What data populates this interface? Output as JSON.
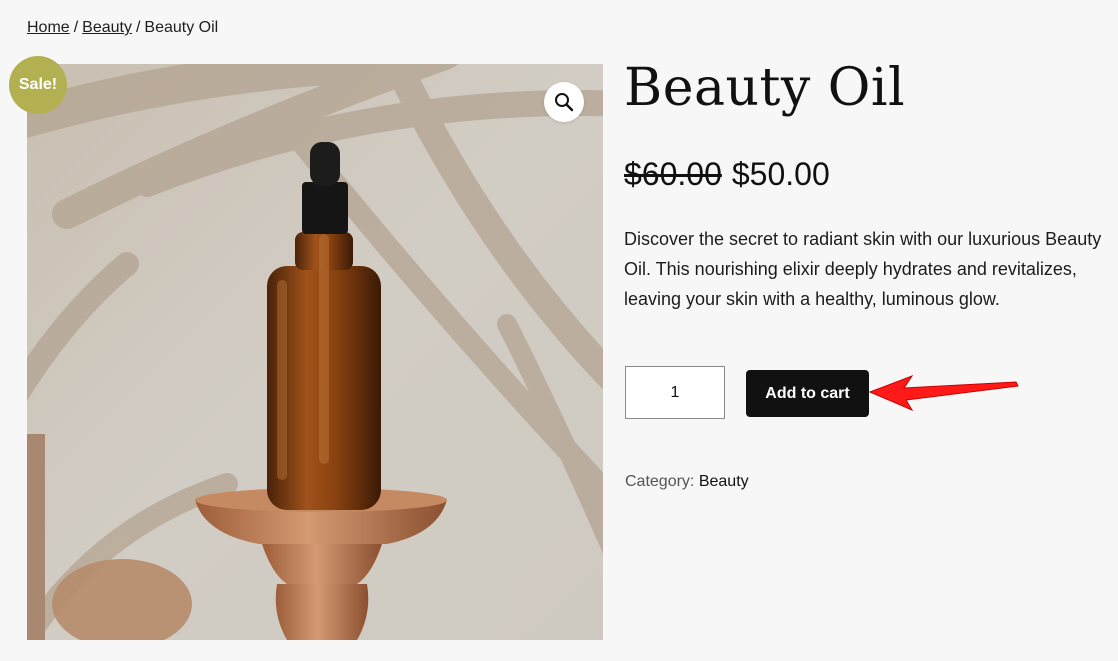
{
  "breadcrumb": {
    "home": "Home",
    "separator": "/",
    "category": "Beauty",
    "current": "Beauty Oil"
  },
  "product": {
    "title": "Beauty Oil",
    "sale_badge": "Sale!",
    "old_price": "$60.00",
    "new_price": "$50.00",
    "description": "Discover the secret to radiant skin with our luxurious Beauty Oil. This nourishing elixir deeply hydrates and revitalizes, leaving your skin with a healthy, luminous glow.",
    "quantity": "1",
    "add_to_cart_label": "Add to cart",
    "category_label": "Category:",
    "category_value": "Beauty"
  },
  "icons": {
    "zoom": "magnifier-icon",
    "annotation": "red-arrow-icon"
  },
  "colors": {
    "sale_badge": "#b3b051",
    "button": "#111111",
    "annotation_arrow": "#ff0000",
    "background": "#f7f7f7"
  }
}
